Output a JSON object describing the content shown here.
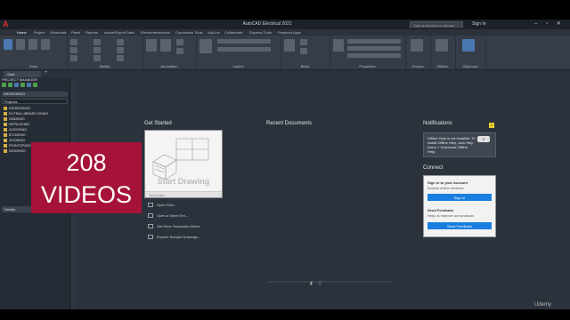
{
  "app": {
    "title": "AutoCAD Electrical 2021",
    "search_placeholder": "Type a keyword or phrase",
    "sign_in": "Sign In",
    "logo": "A"
  },
  "menu_tabs": [
    "Home",
    "Project",
    "Schematic",
    "Panel",
    "Reports",
    "Import/Export Data",
    "Electromechanical",
    "Conversion Tools",
    "Add-ins",
    "Collaborate",
    "Express Tools",
    "Featured Apps"
  ],
  "ribbon_panels": [
    "Draw",
    "Modify",
    "Annotation",
    "Layers",
    "Block",
    "Properties",
    "Groups",
    "Utilities",
    "Clipboard"
  ],
  "doc_tabs": {
    "start": "Start"
  },
  "project_manager": {
    "title": "PROJECT MANAGER",
    "dropdown": "WDSEDEMO",
    "filter": "Projects",
    "tree": [
      "WDSEDEMO",
      "EXTRA LIBRARY DEMO",
      "GBDEMO",
      "NFPA DEMO",
      "ACEDEMO",
      "IECDEMO",
      "JICDEMO",
      "POINT2POINT",
      "WDDEMO"
    ],
    "details": "Details"
  },
  "start": {
    "get_started": "Get Started",
    "start_drawing": "Start Drawing",
    "templates": "Templates",
    "links": [
      "Open Files...",
      "Open a Sheet Set...",
      "Get More Templates Online",
      "Explore Sample Drawings..."
    ],
    "recent": "Recent Documents",
    "notifications": "Notifications",
    "notif_count": "1",
    "notif_text": "Offline Help is not installed. To install Offline Help, click Help menu > Download Offline Help.",
    "notif_badge": "0",
    "connect": "Connect",
    "signin_title": "Sign in to your Account",
    "signin_text": "Access online services",
    "signin_btn": "Sign In",
    "feedback_title": "Send Feedback",
    "feedback_text": "Help us improve our products",
    "feedback_btn": "Send Feedback"
  },
  "overlay": {
    "count": "208",
    "label": "VIDEOS"
  },
  "watermark": "Udemy",
  "colors": {
    "accent": "#a6133a",
    "button": "#1a7ee0",
    "ui_bg": "#2b323c"
  }
}
